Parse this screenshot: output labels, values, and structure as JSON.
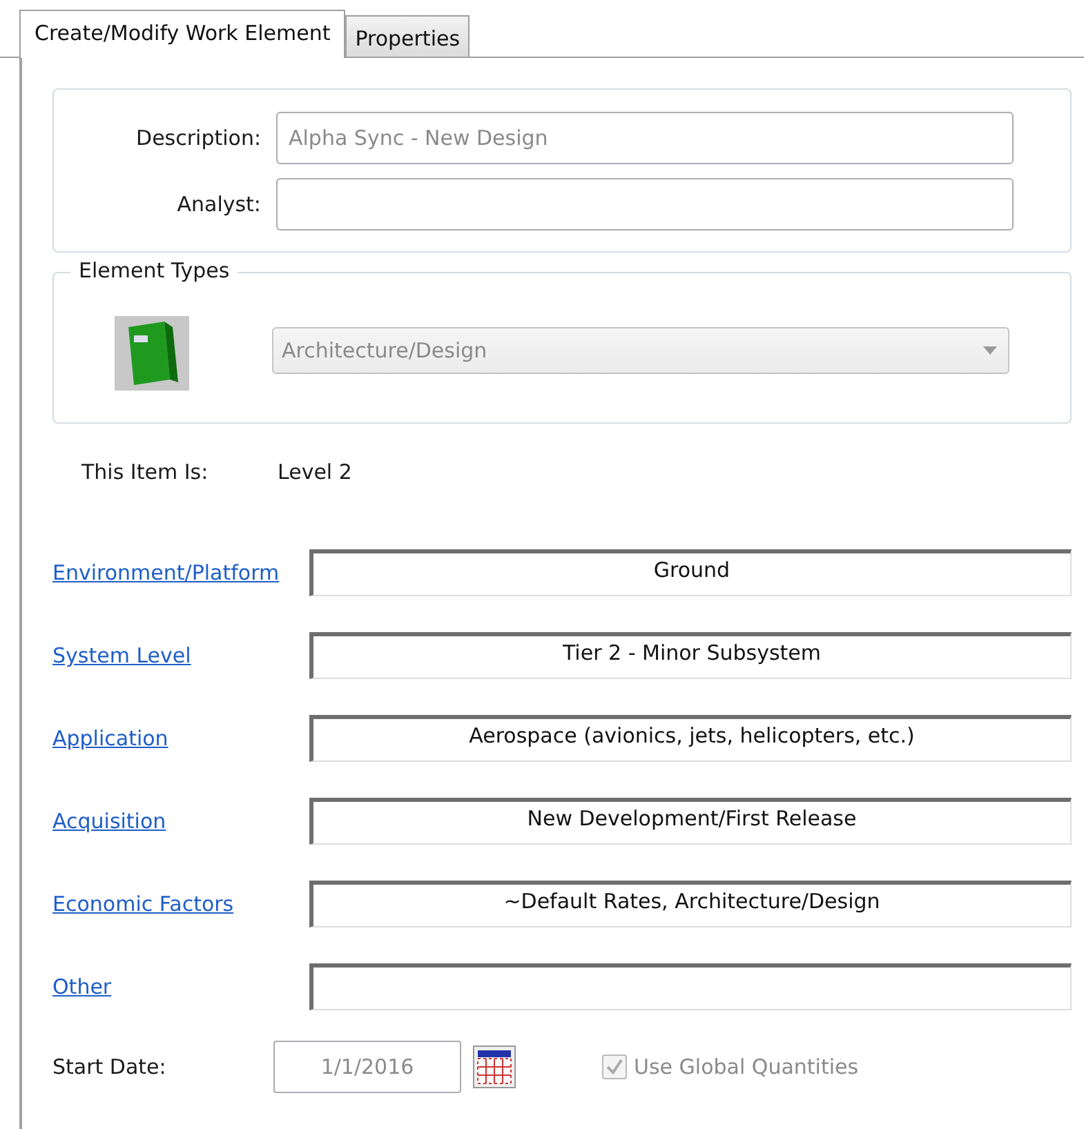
{
  "tabs": [
    {
      "label": "Create/Modify Work Element",
      "selected": true
    },
    {
      "label": "Properties",
      "selected": false
    }
  ],
  "description": {
    "label": "Description:",
    "value": "Alpha Sync - New Design",
    "disabled": true
  },
  "analyst": {
    "label": "Analyst:"
  },
  "element_types": {
    "legend": "Element Types",
    "dropdown": {
      "value": "Architecture/Design",
      "disabled": true
    }
  },
  "item_level": {
    "label": "This Item Is:",
    "value": "Level 2"
  },
  "attributes": [
    {
      "label": "Environment/Platform",
      "value": "Ground"
    },
    {
      "label": "System Level",
      "value": "Tier 2 - Minor Subsystem"
    },
    {
      "label": "Application",
      "value": "Aerospace (avionics, jets, helicopters, etc.)"
    },
    {
      "label": "Acquisition",
      "value": "New Development/First Release"
    },
    {
      "label": "Economic Factors",
      "value": "~Default Rates, Architecture/Design"
    },
    {
      "label": "Other"
    }
  ],
  "start_date": {
    "label": "Start Date:",
    "value": "1/1/2016"
  },
  "use_global_quantities": {
    "label": "Use Global Quantities",
    "checked": true,
    "disabled": true
  }
}
